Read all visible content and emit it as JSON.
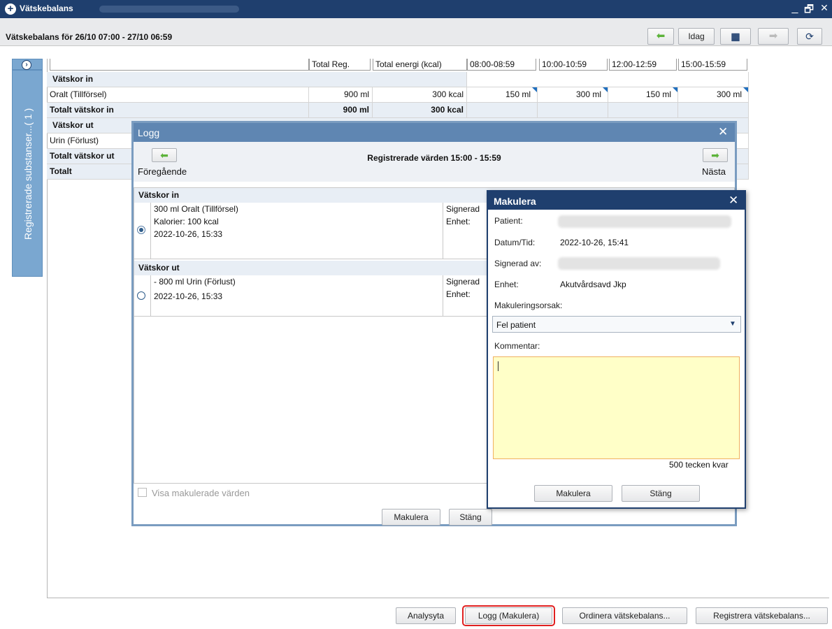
{
  "window": {
    "title": "Vätskebalans",
    "controls": [
      "_",
      "🗗",
      "✕"
    ]
  },
  "header": {
    "title": "Vätskebalans för 26/10 07:00 - 27/10 06:59",
    "today_label": "Idag"
  },
  "side_panel": {
    "label": "Registrerade substanser...( 1 )"
  },
  "table": {
    "columns": [
      "Total Reg.",
      "Total energi (kcal)",
      "08:00-08:59",
      "10:00-10:59",
      "12:00-12:59",
      "15:00-15:59"
    ],
    "sections": {
      "in_title": "Vätskor in",
      "in_row": {
        "label": "Oralt (Tillförsel)",
        "total": "900 ml",
        "energy": "300 kcal",
        "slots": [
          "150 ml",
          "300 ml",
          "150 ml",
          "300 ml"
        ]
      },
      "in_total": {
        "label": "Totalt vätskor in",
        "total": "900 ml",
        "energy": "300 kcal"
      },
      "out_title": "Vätskor ut",
      "out_row": {
        "label": "Urin (Förlust)"
      },
      "out_total": {
        "label": "Totalt vätskor ut"
      },
      "total": {
        "label": "Totalt"
      }
    }
  },
  "log_dialog": {
    "title": "Logg",
    "prev_label": "Föregående",
    "next_label": "Nästa",
    "heading": "Registrerade värden 15:00 - 15:59",
    "in_section": "Vätskor in",
    "in_entry": {
      "line1": "300 ml Oralt (Tillförsel)",
      "line2": "Kalorier: 100 kcal",
      "line3": "2022-10-26, 15:33",
      "signed": "Signerad",
      "unit": "Enhet:"
    },
    "out_section": "Vätskor ut",
    "out_entry": {
      "line1": "- 800 ml Urin (Förlust)",
      "line2": "2022-10-26, 15:33",
      "signed": "Signerad",
      "unit": "Enhet:"
    },
    "show_voided": "Visa makulerade värden",
    "void_button": "Makulera",
    "close_button": "Stäng"
  },
  "void_dialog": {
    "title": "Makulera",
    "patient_label": "Patient:",
    "datetime_label": "Datum/Tid:",
    "datetime_value": "2022-10-26, 15:41",
    "signed_label": "Signerad av:",
    "unit_label": "Enhet:",
    "unit_value": "Akutvårdsavd Jkp",
    "reason_label": "Makuleringsorsak:",
    "reason_value": "Fel patient",
    "comment_label": "Kommentar:",
    "chars_left": "500 tecken kvar",
    "void_button": "Makulera",
    "close_button": "Stäng"
  },
  "footer": {
    "analysis": "Analysyta",
    "log": "Logg (Makulera)",
    "order": "Ordinera vätskebalans...",
    "register": "Registrera vätskebalans..."
  },
  "colors": {
    "titlebar": "#1f3f6e",
    "highlight": "#e02020",
    "comment_bg": "#ffffc8",
    "arrow": "#5db33a"
  }
}
